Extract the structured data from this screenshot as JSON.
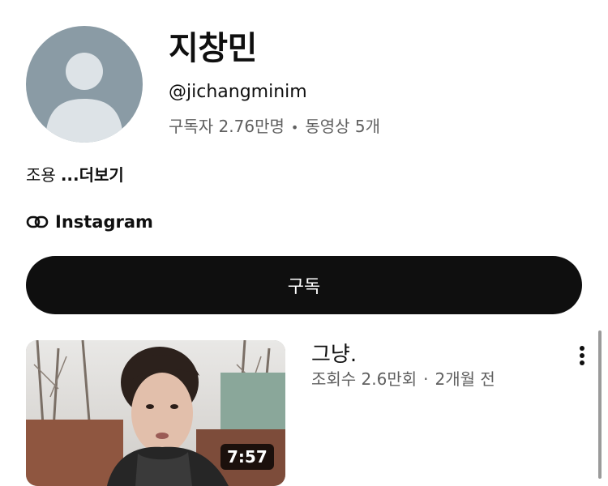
{
  "channel": {
    "name": "지창민",
    "handle": "@jichangminim",
    "subscribers": "구독자 2.76만명",
    "stats_separator": "•",
    "video_count": "동영상 5개",
    "description": "조용",
    "more_label": "...더보기",
    "link_label": "Instagram",
    "link_icon": "link-icon",
    "avatar_icon": "default-avatar-icon"
  },
  "subscribe_label": "구독",
  "video": {
    "title": "그냥.",
    "views": "조회수 2.6만회",
    "meta_separator": "·",
    "age": "2개월 전",
    "duration": "7:57",
    "menu_icon": "more-vert-icon"
  }
}
